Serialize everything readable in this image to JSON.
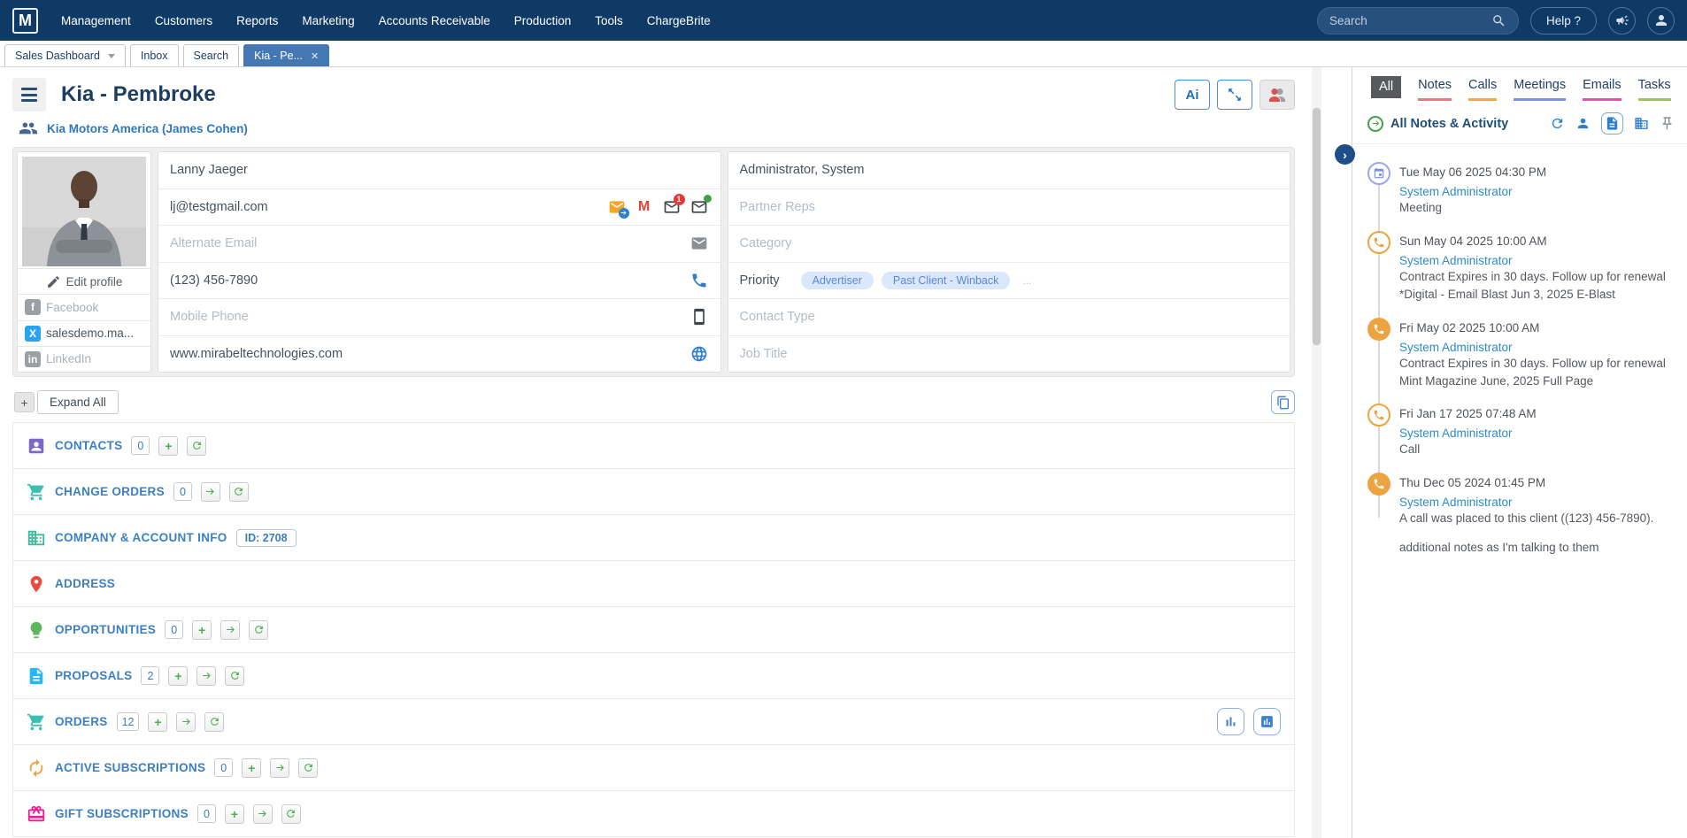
{
  "nav": {
    "logo": "M",
    "items": [
      "Management",
      "Customers",
      "Reports",
      "Marketing",
      "Accounts Receivable",
      "Production",
      "Tools",
      "ChargeBrite"
    ],
    "search_placeholder": "Search",
    "help_label": "Help ?"
  },
  "tabs": [
    {
      "label": "Sales Dashboard",
      "caret": true,
      "active": false,
      "closable": false
    },
    {
      "label": "Inbox",
      "caret": false,
      "active": false,
      "closable": false
    },
    {
      "label": "Search",
      "caret": false,
      "active": false,
      "closable": false
    },
    {
      "label": "Kia - Pe...",
      "caret": false,
      "active": true,
      "closable": true
    }
  ],
  "header": {
    "title": "Kia - Pembroke",
    "company_link": "Kia Motors America (James Cohen)",
    "ai_button": "Ai"
  },
  "profile": {
    "edit_label": "Edit profile",
    "links": [
      {
        "network": "facebook",
        "label": "Facebook",
        "placeholder": true
      },
      {
        "network": "x",
        "letter": "X",
        "label": "salesdemo.ma...",
        "placeholder": false
      },
      {
        "network": "linkedin",
        "label": "LinkedIn",
        "placeholder": true
      }
    ]
  },
  "fields": {
    "left": [
      {
        "text": "Lanny Jaeger",
        "placeholder": false,
        "icons": []
      },
      {
        "text": "lj@testgmail.com",
        "placeholder": false,
        "icons": [
          {
            "name": "mail-forward"
          },
          {
            "name": "gmail",
            "letter": "M"
          },
          {
            "name": "mail-unread",
            "badge": "1"
          },
          {
            "name": "mail-dot"
          }
        ]
      },
      {
        "text": "Alternate Email",
        "placeholder": true,
        "icons": [
          {
            "name": "envelope"
          }
        ]
      },
      {
        "text": "(123) 456-7890",
        "placeholder": false,
        "icons": [
          {
            "name": "phone"
          }
        ]
      },
      {
        "text": "Mobile Phone",
        "placeholder": true,
        "icons": [
          {
            "name": "mobile"
          }
        ]
      },
      {
        "text": "www.mirabeltechnologies.com",
        "placeholder": false,
        "icons": [
          {
            "name": "globe"
          }
        ]
      }
    ],
    "right": [
      {
        "text": "Administrator, System",
        "placeholder": false
      },
      {
        "text": "Partner Reps",
        "placeholder": true
      },
      {
        "text": "Category",
        "placeholder": true
      },
      {
        "text": "Priority",
        "placeholder": false,
        "chips": [
          "Advertiser",
          "Past Client - Winback"
        ],
        "more": "..."
      },
      {
        "text": "Contact Type",
        "placeholder": true
      },
      {
        "text": "Job Title",
        "placeholder": true
      }
    ]
  },
  "expand_all": {
    "plus": "+",
    "label": "Expand All"
  },
  "sections": [
    {
      "icon": "book",
      "color": "#7b68c8",
      "label": "CONTACTS",
      "count": "0",
      "actions": [
        "add",
        "refresh"
      ]
    },
    {
      "icon": "cart",
      "color": "#3bbfae",
      "label": "CHANGE ORDERS",
      "count": "0",
      "actions": [
        "go",
        "refresh"
      ]
    },
    {
      "icon": "building",
      "color": "#3dbb9a",
      "label": "COMPANY & ACCOUNT INFO",
      "badge": "ID: 2708"
    },
    {
      "icon": "pin",
      "color": "#e74c3c",
      "label": "ADDRESS"
    },
    {
      "icon": "bulb",
      "color": "#5cb85c",
      "label": "OPPORTUNITIES",
      "count": "0",
      "actions": [
        "add",
        "go",
        "refresh"
      ]
    },
    {
      "icon": "doc",
      "color": "#29b6f6",
      "label": "PROPOSALS",
      "count": "2",
      "actions": [
        "add",
        "go",
        "refresh"
      ]
    },
    {
      "icon": "cart",
      "color": "#3bbfae",
      "label": "ORDERS",
      "count": "12",
      "actions": [
        "add",
        "go",
        "refresh"
      ],
      "right_buttons": [
        "chart",
        "report"
      ]
    },
    {
      "icon": "renew",
      "color": "#e8a33d",
      "label": "ACTIVE SUBSCRIPTIONS",
      "count": "0",
      "actions": [
        "add",
        "go",
        "refresh"
      ]
    },
    {
      "icon": "gift",
      "color": "#ec1e95",
      "label": "GIFT SUBSCRIPTIONS",
      "count": "0",
      "actions": [
        "add",
        "go",
        "refresh"
      ]
    }
  ],
  "activity": {
    "tabs": [
      {
        "label": "All",
        "active": true,
        "color": ""
      },
      {
        "label": "Notes",
        "active": false,
        "color": "#ef7680"
      },
      {
        "label": "Calls",
        "active": false,
        "color": "#efa93f"
      },
      {
        "label": "Meetings",
        "active": false,
        "color": "#7b8ef2"
      },
      {
        "label": "Emails",
        "active": false,
        "color": "#ed4fae"
      },
      {
        "label": "Tasks",
        "active": false,
        "color": "#9ec54d"
      }
    ],
    "header": "All Notes & Activity",
    "entries": [
      {
        "icon": "calendar",
        "variant": "outline-blue",
        "date": "Tue May 06 2025 04:30 PM",
        "author": "System Administrator",
        "lines": [
          "Meeting"
        ]
      },
      {
        "icon": "phone",
        "variant": "outline-orange",
        "date": "Sun May 04 2025 10:00 AM",
        "author": "System Administrator",
        "lines": [
          "Contract Expires in 30 days. Follow up for renewal",
          "*Digital - Email Blast Jun 3, 2025 E-Blast"
        ]
      },
      {
        "icon": "phone",
        "variant": "filled-orange",
        "date": "Fri May 02 2025 10:00 AM",
        "author": "System Administrator",
        "lines": [
          "Contract Expires in 30 days. Follow up for renewal",
          "Mint Magazine June, 2025 Full Page"
        ]
      },
      {
        "icon": "phone",
        "variant": "outline-orange",
        "date": "Fri Jan 17 2025 07:48 AM",
        "author": "System Administrator",
        "lines": [
          "Call"
        ]
      },
      {
        "icon": "phone",
        "variant": "filled-orange",
        "date": "Thu Dec 05 2024 01:45 PM",
        "author": "System Administrator",
        "lines": [
          "A call was placed to this client ((123) 456-7890).",
          "",
          "additional notes as I'm talking to them"
        ]
      }
    ]
  }
}
